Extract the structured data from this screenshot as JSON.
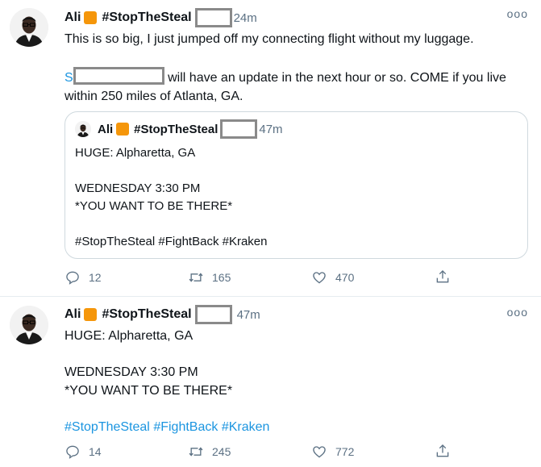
{
  "tweets": [
    {
      "author": "Ali",
      "hashtag_name": "#StopTheSteal",
      "time": "24m",
      "line1": "This is so big, I just jumped off my connecting flight without my luggage.",
      "mention_fragment": "S",
      "line2_rest": "will have an update in the next hour or so. COME if you live",
      "line3": "within 250 miles of Atlanta, GA.",
      "quote": {
        "author": "Ali",
        "hashtag_name": "#StopTheSteal",
        "time": "47m",
        "l1": "HUGE: Alpharetta, GA",
        "l2": "WEDNESDAY 3:30 PM",
        "l3": "*YOU WANT TO BE THERE*",
        "l4": "#StopTheSteal #FightBack #Kraken"
      },
      "replies": "12",
      "retweets": "165",
      "likes": "470"
    },
    {
      "author": "Ali",
      "hashtag_name": "#StopTheSteal",
      "time": "47m",
      "l1": "HUGE: Alpharetta, GA",
      "l2": "WEDNESDAY 3:30 PM",
      "l3": "*YOU WANT TO BE THERE*",
      "tags": [
        "#StopTheSteal",
        "#FightBack",
        "#Kraken"
      ],
      "replies": "14",
      "retweets": "245",
      "likes": "772"
    }
  ],
  "icons": {
    "reply": "reply-icon",
    "retweet": "retweet-icon",
    "like": "heart-icon",
    "share": "share-icon",
    "more": "more-icon"
  },
  "colors": {
    "badge": "#f5960a",
    "link": "#1b95e0",
    "muted": "#5b7083"
  },
  "more_glyph": "ooo"
}
